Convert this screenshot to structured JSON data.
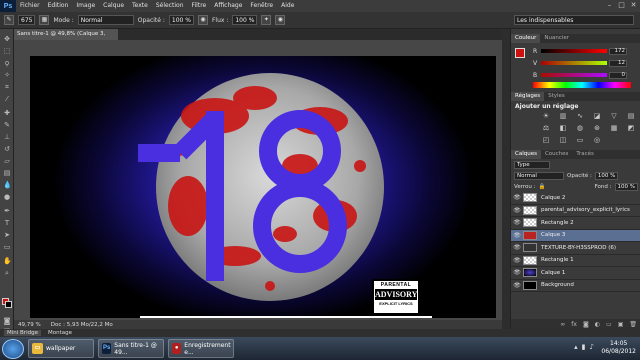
{
  "app": {
    "logo": "Ps"
  },
  "menu": [
    "Fichier",
    "Edition",
    "Image",
    "Calque",
    "Texte",
    "Sélection",
    "Filtre",
    "Affichage",
    "Fenêtre",
    "Aide"
  ],
  "options": {
    "brush_size": "675",
    "mode_label": "Mode :",
    "mode_value": "Normal",
    "opacity_label": "Opacité :",
    "opacity_value": "100 %",
    "flux_label": "Flux :",
    "flux_value": "100 %",
    "workspace": "Les indispensables"
  },
  "document": {
    "tab_title": "Sans titre-1 @ 49,8% (Calque 3, RVB/8) *"
  },
  "artwork": {
    "number": "18",
    "advisory_top": "PARENTAL",
    "advisory_mid": "ADVISORY",
    "advisory_bot": "EXPLICIT LYRICS"
  },
  "status": {
    "zoom": "49,79 %",
    "doc": "Doc : 5,93 Mo/22,2 Mo"
  },
  "minibridge": {
    "tabs": [
      "Mini Bridge",
      "Montage"
    ]
  },
  "color_panel": {
    "tabs": [
      "Couleur",
      "Nuancier"
    ],
    "channels": [
      {
        "ch": "R",
        "value": "172"
      },
      {
        "ch": "V",
        "value": "12"
      },
      {
        "ch": "B",
        "value": "0"
      }
    ],
    "fg_color": "#cc1111"
  },
  "adjust_panel": {
    "tabs": [
      "Réglages",
      "Styles"
    ],
    "title": "Ajouter un réglage",
    "icons": [
      "brightness-icon",
      "levels-icon",
      "curves-icon",
      "exposure-icon",
      "vibrance-icon",
      "hue-icon",
      "balance-icon",
      "bw-icon",
      "photofilter-icon",
      "mixer-icon",
      "lookup-icon",
      "invert-icon",
      "posterize-icon",
      "threshold-icon",
      "gradientmap-icon",
      "selectivecolor-icon"
    ]
  },
  "layers_panel": {
    "tabs": [
      "Calques",
      "Couches",
      "Tracés"
    ],
    "filter": "Type",
    "blend": "Normal",
    "opacity_label": "Opacité :",
    "opacity": "100 %",
    "lock_label": "Verrou :",
    "fill_label": "Fond :",
    "fill": "100 %",
    "layers": [
      {
        "name": "Calque 2",
        "thumb": "chk",
        "selected": false
      },
      {
        "name": "parental_advisory_explicit_lyrics",
        "thumb": "chk",
        "selected": false
      },
      {
        "name": "Rectangle 2",
        "thumb": "chk",
        "selected": false
      },
      {
        "name": "Calque 3",
        "thumb": "red",
        "selected": true
      },
      {
        "name": "TEXTURE-BY-H3SSPROD (6)",
        "thumb": "fx",
        "selected": false
      },
      {
        "name": "Rectangle 1",
        "thumb": "chk",
        "selected": false
      },
      {
        "name": "Calque 1",
        "thumb": "blue",
        "selected": false
      },
      {
        "name": "Background",
        "thumb": "dark",
        "selected": false
      }
    ]
  },
  "taskbar": {
    "tasks": [
      {
        "label": "wallpaper",
        "icon": "folder-icon"
      },
      {
        "label": "Sans titre-1 @ 49...",
        "icon": "photoshop-icon"
      },
      {
        "label": "Enregistrement e...",
        "icon": "recorder-icon"
      }
    ],
    "time": "14:05",
    "date": "06/08/2012"
  }
}
